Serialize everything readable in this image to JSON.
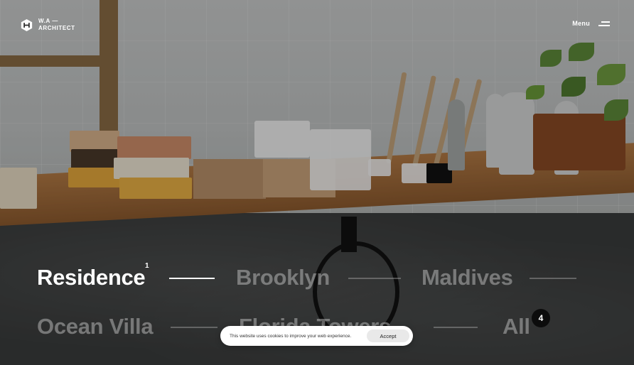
{
  "brand": {
    "name_line1": "W.A —",
    "name_line2": "ARCHITECT"
  },
  "menu": {
    "label": "Menu"
  },
  "projects": [
    {
      "label": "Residence",
      "index": "1",
      "active": true
    },
    {
      "label": "Brooklyn",
      "active": false
    },
    {
      "label": "Maldives",
      "active": false
    },
    {
      "label": "Ocean Villa",
      "active": false
    },
    {
      "label": "Florida Towers",
      "active": false
    },
    {
      "label": "All",
      "count": "4",
      "active": false
    }
  ],
  "cookie": {
    "message": "This website uses cookies to improve your web experience.",
    "accept_label": "Accept"
  }
}
